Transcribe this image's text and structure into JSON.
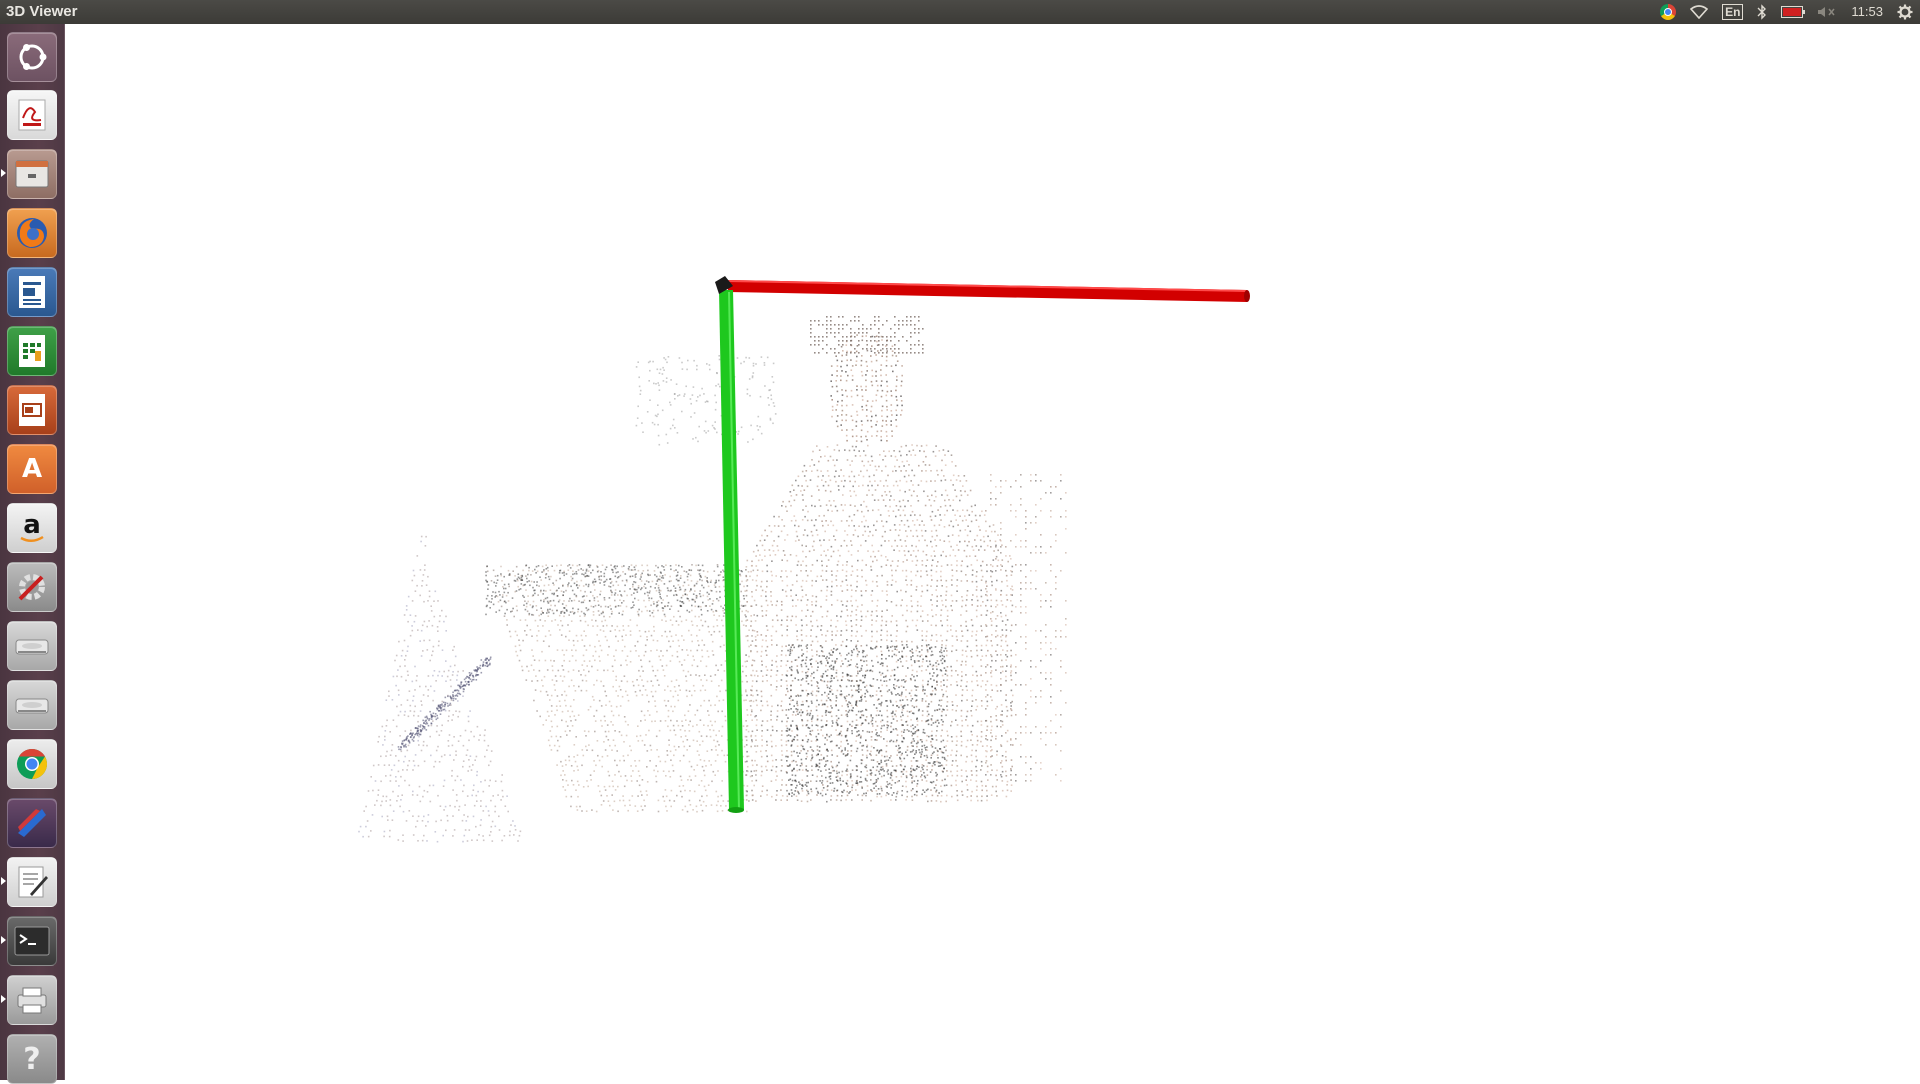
{
  "window": {
    "title": "3D Viewer"
  },
  "panel": {
    "keyboard_layout": "En",
    "clock": "11:53",
    "tray_icons": [
      "chrome-icon",
      "wifi-icon",
      "keyboard-layout-icon",
      "bluetooth-icon",
      "battery-icon",
      "volume-muted-icon",
      "clock",
      "settings-gear-icon"
    ],
    "battery_status_color": "#d02020"
  },
  "launcher": {
    "items": [
      {
        "name": "ubuntu-dash",
        "icon": "ubuntu-logo-icon"
      },
      {
        "name": "document-viewer",
        "icon": "pdf-viewer-icon"
      },
      {
        "name": "file-cabinet",
        "icon": "files-icon"
      },
      {
        "name": "firefox",
        "icon": "firefox-icon"
      },
      {
        "name": "libreoffice-writer",
        "icon": "writer-icon"
      },
      {
        "name": "libreoffice-calc",
        "icon": "calc-icon"
      },
      {
        "name": "libreoffice-impress",
        "icon": "impress-icon"
      },
      {
        "name": "software-center",
        "icon": "software-center-icon"
      },
      {
        "name": "amazon",
        "icon": "amazon-icon"
      },
      {
        "name": "system-settings",
        "icon": "system-settings-icon"
      },
      {
        "name": "drive-1",
        "icon": "hard-drive-icon"
      },
      {
        "name": "drive-2",
        "icon": "hard-drive-icon"
      },
      {
        "name": "chrome",
        "icon": "chrome-icon"
      },
      {
        "name": "pycharm-like-app",
        "icon": "ide-icon"
      },
      {
        "name": "text-editor",
        "icon": "text-editor-icon"
      },
      {
        "name": "terminal",
        "icon": "terminal-icon"
      },
      {
        "name": "printer",
        "icon": "printer-icon"
      },
      {
        "name": "help",
        "icon": "help-icon"
      }
    ]
  },
  "viewer": {
    "axes": [
      {
        "name": "x-axis",
        "color": "#d20000"
      },
      {
        "name": "y-axis",
        "color": "#1ec81e"
      }
    ],
    "content": "point-cloud"
  }
}
